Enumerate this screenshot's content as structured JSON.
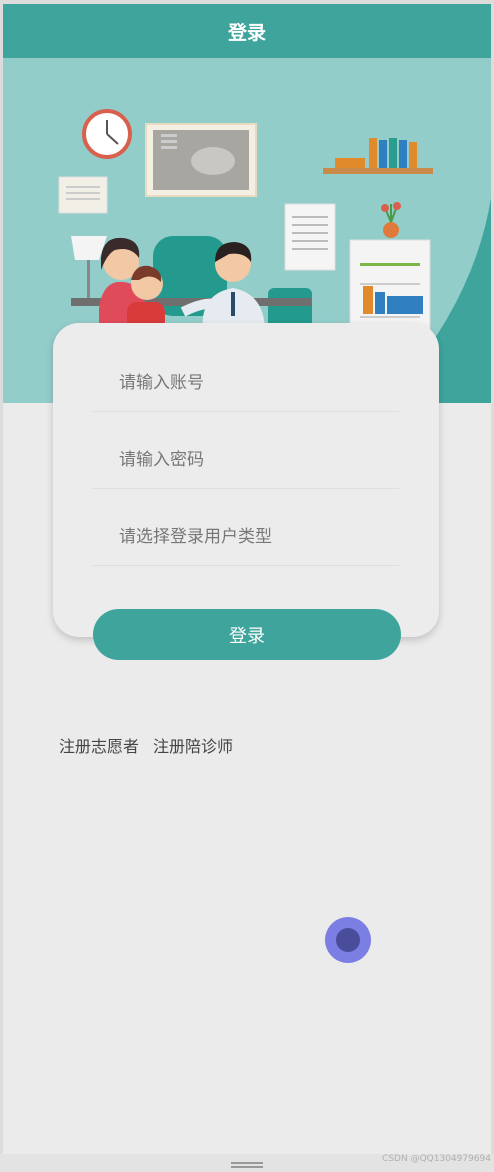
{
  "header": {
    "title": "登录"
  },
  "form": {
    "account_placeholder": "请输入账号",
    "password_placeholder": "请输入密码",
    "usertype_placeholder": "请选择登录用户类型",
    "login_label": "登录"
  },
  "links": {
    "register_volunteer": "注册志愿者",
    "register_escort": "注册陪诊师"
  },
  "watermark": "CSDN @QQ1304979694",
  "colors": {
    "accent": "#3fa59c",
    "fab": "#7b7fe4",
    "background": "#ebebeb"
  },
  "icons": {
    "floating_button": "assistive-touch-icon"
  }
}
